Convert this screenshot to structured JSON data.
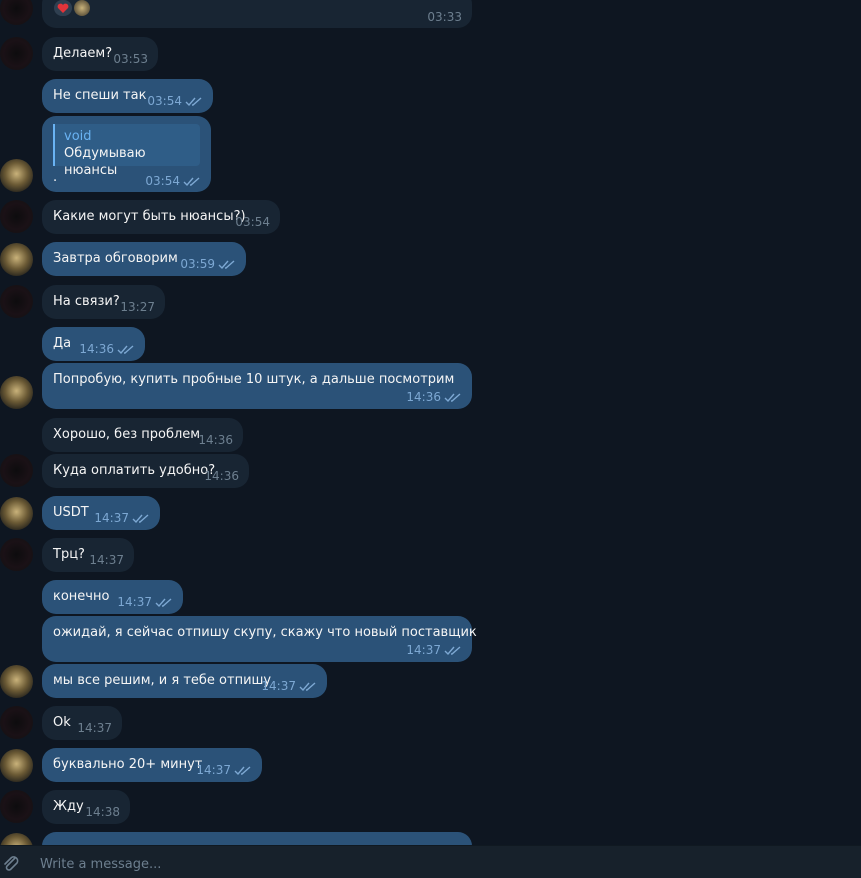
{
  "messages": [
    {
      "dir": "in",
      "text": "",
      "time": "03:33",
      "reactions": [
        "heart",
        "avatar"
      ]
    },
    {
      "dir": "in",
      "text": "Делаем?",
      "time": "03:53"
    },
    {
      "dir": "out",
      "text": "Не спеши так",
      "time": "03:54"
    },
    {
      "dir": "out",
      "text": ".",
      "time": "03:54",
      "reply": {
        "name": "void",
        "text": "Обдумываю нюансы"
      }
    },
    {
      "dir": "in",
      "text": "Какие могут быть нюансы?)",
      "time": "03:54"
    },
    {
      "dir": "out",
      "text": "Завтра обговорим",
      "time": "03:59"
    },
    {
      "dir": "in",
      "text": "На связи?",
      "time": "13:27"
    },
    {
      "dir": "out",
      "text": "Да",
      "time": "14:36"
    },
    {
      "dir": "out",
      "text": "Попробую, купить пробные 10 штук, а дальше посмотрим",
      "time": "14:36"
    },
    {
      "dir": "in",
      "text": "Хорошо, без проблем",
      "time": "14:36"
    },
    {
      "dir": "in",
      "text": "Куда оплатить удобно?",
      "time": "14:36"
    },
    {
      "dir": "out",
      "text": "USDT",
      "time": "14:37"
    },
    {
      "dir": "in",
      "text": "Трц?",
      "time": "14:37"
    },
    {
      "dir": "out",
      "text": "конечно",
      "time": "14:37"
    },
    {
      "dir": "out",
      "text": "ожидай, я сейчас отпишу скупу, скажу что новый поставщик",
      "time": "14:37"
    },
    {
      "dir": "out",
      "text": "мы все решим, и я тебе отпишу",
      "time": "14:37"
    },
    {
      "dir": "in",
      "text": "Ok",
      "time": "14:37"
    },
    {
      "dir": "out",
      "text": "буквально 20+ минут",
      "time": "14:37"
    },
    {
      "dir": "in",
      "text": "Жду",
      "time": "14:38"
    }
  ],
  "composer": {
    "placeholder": "Write a message..."
  },
  "colors": {
    "background": "#0e1621",
    "incoming": "#182533",
    "outgoing": "#2b5278",
    "accent": "#6ab3f3"
  },
  "icons": {
    "attach": "paperclip-icon",
    "read": "double-check-icon",
    "reaction": "heart-icon"
  }
}
